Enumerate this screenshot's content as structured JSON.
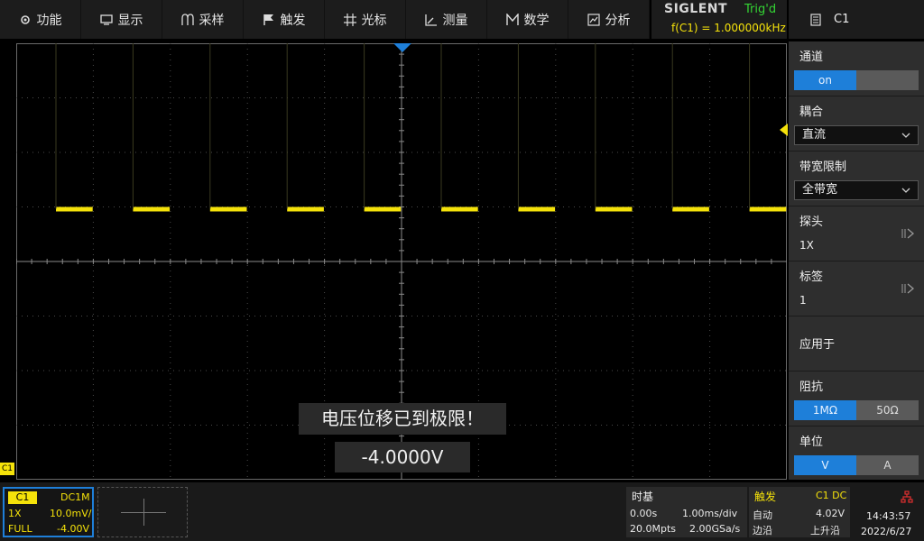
{
  "menu": [
    {
      "label": "功能",
      "icon": "gear-icon"
    },
    {
      "label": "显示",
      "icon": "display-icon"
    },
    {
      "label": "采样",
      "icon": "acquire-icon"
    },
    {
      "label": "触发",
      "icon": "flag-icon"
    },
    {
      "label": "光标",
      "icon": "cursor-icon"
    },
    {
      "label": "测量",
      "icon": "measure-icon"
    },
    {
      "label": "数学",
      "icon": "math-icon"
    },
    {
      "label": "分析",
      "icon": "analysis-icon"
    }
  ],
  "brand": {
    "logo": "SIGLENT",
    "trig_status": "Trig'd",
    "freq": "f(C1) = 1.000000kHz"
  },
  "panel": {
    "header": "C1",
    "channel": {
      "title": "通道",
      "on": "on",
      "off": ""
    },
    "coupling": {
      "title": "耦合",
      "value": "直流"
    },
    "bandwidth": {
      "title": "带宽限制",
      "value": "全带宽"
    },
    "probe": {
      "title": "探头",
      "value": "1X"
    },
    "label": {
      "title": "标签",
      "value": "1"
    },
    "apply": {
      "title": "应用于"
    },
    "impedance": {
      "title": "阻抗",
      "opt1": "1MΩ",
      "opt2": "50Ω"
    },
    "unit": {
      "title": "单位",
      "opt1": "V",
      "opt2": "A"
    }
  },
  "ch_marker": "C1",
  "message": {
    "title": "电压位移已到极限！",
    "value": "-4.0000V"
  },
  "channel_box": {
    "tag": "C1",
    "coupling": "DC1M",
    "probe": "1X",
    "scale": "10.0mV/",
    "bw": "FULL",
    "offset": "-4.00V"
  },
  "timebase": {
    "title": "时基",
    "delay": "0.00s",
    "scale": "1.00ms/div",
    "depth": "20.0Mpts",
    "rate": "2.00GSa/s"
  },
  "trigger": {
    "title": "触发",
    "source": "C1 DC",
    "mode": "自动",
    "level": "4.02V",
    "type": "边沿",
    "slope": "上升沿"
  },
  "clock": {
    "time": "14:43:57",
    "date": "2022/6/27"
  },
  "colors": {
    "ch1": "#f5e20a",
    "accent": "#1e7fd9",
    "trig": "#34d534"
  },
  "waveform": {
    "period_ms": 1.0,
    "duty": 0.5,
    "level_div": 1.0,
    "baseline_hidden": true
  }
}
